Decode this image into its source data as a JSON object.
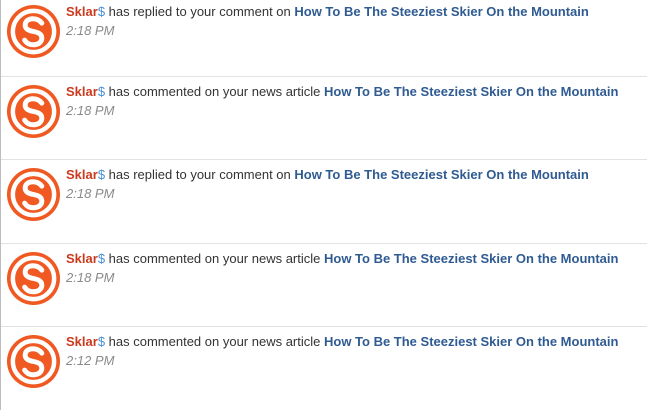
{
  "colors": {
    "username": "#cc3a1e",
    "dollar_sign": "#4a90d9",
    "article_link": "#2f5b92",
    "timestamp": "#8a8a8a",
    "avatar_orange": "#f05a22"
  },
  "notifications": [
    {
      "avatar_icon": "orange-s-logo-icon",
      "user_name": "Sklar",
      "user_suffix": "$",
      "action": " has replied to your comment on ",
      "article": "How To Be The Steeziest Skier On the Mountain",
      "time": "2:18 PM"
    },
    {
      "avatar_icon": "orange-s-logo-icon",
      "user_name": "Sklar",
      "user_suffix": "$",
      "action": " has commented on your news article ",
      "article": "How To Be The Steeziest Skier On the Mountain",
      "time": "2:18 PM"
    },
    {
      "avatar_icon": "orange-s-logo-icon",
      "user_name": "Sklar",
      "user_suffix": "$",
      "action": " has replied to your comment on ",
      "article": "How To Be The Steeziest Skier On the Mountain",
      "time": "2:18 PM"
    },
    {
      "avatar_icon": "orange-s-logo-icon",
      "user_name": "Sklar",
      "user_suffix": "$",
      "action": " has commented on your news article ",
      "article": "How To Be The Steeziest Skier On the Mountain",
      "time": "2:18 PM"
    },
    {
      "avatar_icon": "orange-s-logo-icon",
      "user_name": "Sklar",
      "user_suffix": "$",
      "action": " has commented on your news article ",
      "article": "How To Be The Steeziest Skier On the Mountain",
      "time": "2:12 PM"
    }
  ]
}
